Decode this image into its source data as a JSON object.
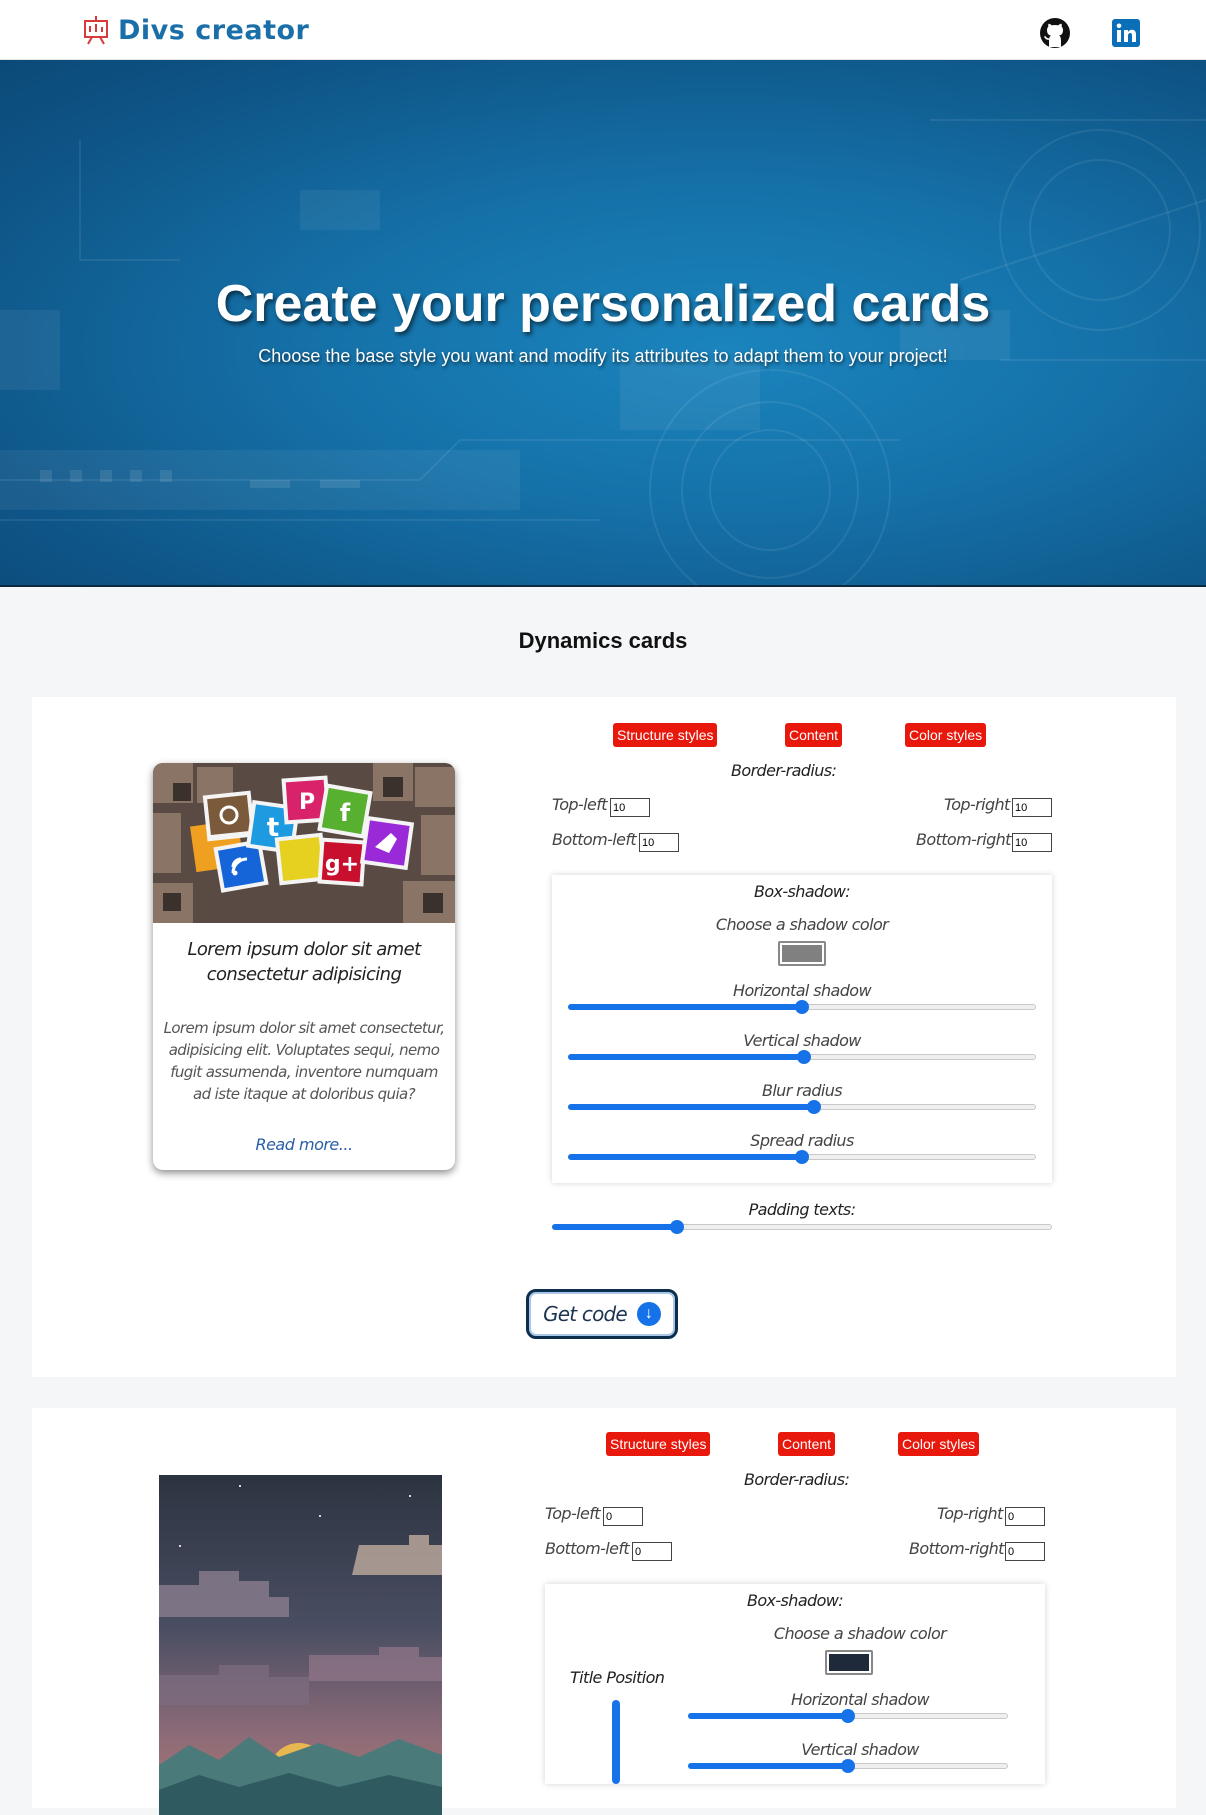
{
  "navbar": {
    "brand": "Divs creator",
    "links": [
      {
        "name": "github-icon"
      },
      {
        "name": "linkedin-icon"
      }
    ]
  },
  "hero": {
    "title": "Create your personalized cards",
    "subtitle": "Choose the base style you want and modify its attributes to adapt them to your project!"
  },
  "section": {
    "title": "Dynamics cards"
  },
  "colors": {
    "brand": "#1a6fa8",
    "accent_red": "#e8180c",
    "slider_blue": "#1672e8",
    "shadow_color_1": "#808080",
    "shadow_color_2": "#1e2a3a"
  },
  "card1": {
    "title": "Lorem ipsum dolor sit amet consectetur adipisicing",
    "text": "Lorem ipsum dolor sit amet consectetur, adipisicing elit. Voluptates sequi, nemo fugit assumenda, inventore numquam ad iste itaque at doloribus quia?",
    "link": "Read more..."
  },
  "controls1": {
    "tabs": [
      "Structure styles",
      "Content",
      "Color styles"
    ],
    "border_radius_label": "Border-radius:",
    "top_left_label": "Top-left",
    "top_right_label": "Top-right",
    "bottom_left_label": "Bottom-left",
    "bottom_right_label": "Bottom-right",
    "top_left": "10",
    "top_right": "10",
    "bottom_left": "10",
    "bottom_right": "10",
    "box_shadow_label": "Box-shadow:",
    "shadow_color_label": "Choose a shadow color",
    "sliders": [
      {
        "label": "Horizontal shadow",
        "value": 0.5
      },
      {
        "label": "Vertical shadow",
        "value": 0.505
      },
      {
        "label": "Blur radius",
        "value": 0.525
      },
      {
        "label": "Spread radius",
        "value": 0.5
      }
    ],
    "padding_label": "Padding texts:",
    "padding_value": 0.25,
    "get_code": "Get code"
  },
  "controls2": {
    "tabs": [
      "Structure styles",
      "Content",
      "Color styles"
    ],
    "border_radius_label": "Border-radius:",
    "top_left_label": "Top-left",
    "top_right_label": "Top-right",
    "bottom_left_label": "Bottom-left",
    "bottom_right_label": "Bottom-right",
    "top_left": "0",
    "top_right": "0",
    "bottom_left": "0",
    "bottom_right": "0",
    "box_shadow_label": "Box-shadow:",
    "title_position_label": "Title Position",
    "shadow_color_label": "Choose a shadow color",
    "sliders": [
      {
        "label": "Horizontal shadow",
        "value": 0.5
      },
      {
        "label": "Vertical shadow",
        "value": 0.5
      }
    ]
  }
}
